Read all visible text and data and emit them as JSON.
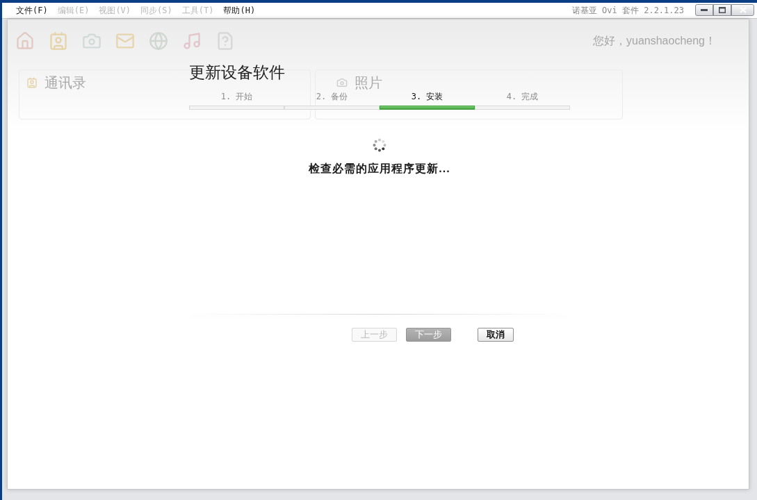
{
  "window": {
    "title": "诺基亚 Ovi 套件 2.2.1.23"
  },
  "menu": [
    {
      "label": "文件(F)",
      "disabled": false
    },
    {
      "label": "编辑(E)",
      "disabled": true
    },
    {
      "label": "视图(V)",
      "disabled": true
    },
    {
      "label": "同步(S)",
      "disabled": true
    },
    {
      "label": "工具(T)",
      "disabled": true
    },
    {
      "label": "帮助(H)",
      "disabled": false
    }
  ],
  "background": {
    "greeting": "您好，yuanshaocheng！",
    "panels": [
      {
        "title": "通讯录"
      },
      {
        "title": "照片"
      }
    ]
  },
  "dialog": {
    "title": "更新设备软件",
    "steps": [
      {
        "label": "1. 开始",
        "selected": false
      },
      {
        "label": "2. 备份",
        "selected": false
      },
      {
        "label": "3. 安装",
        "selected": true
      },
      {
        "label": "4. 完成",
        "selected": false
      }
    ],
    "status": "检查必需的应用程序更新...",
    "buttons": [
      {
        "label": "上一步",
        "kind": "secondary",
        "disabled": true
      },
      {
        "label": "下一步",
        "kind": "primary",
        "disabled": true
      },
      {
        "label": "取消",
        "kind": "secondary",
        "disabled": false
      }
    ]
  }
}
